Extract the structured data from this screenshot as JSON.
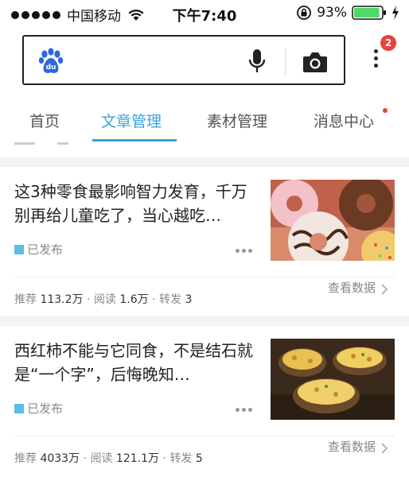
{
  "status_bar": {
    "carrier": "中国移动",
    "time": "下午7:40",
    "battery_percent": "93%",
    "battery_level": 0.93
  },
  "search": {
    "logo_text": "du",
    "notification_count": "2"
  },
  "tabs": [
    {
      "label": "首页",
      "active": false
    },
    {
      "label": "文章管理",
      "active": true
    },
    {
      "label": "素材管理",
      "active": false
    },
    {
      "label": "消息中心",
      "active": false,
      "has_dot": true
    }
  ],
  "articles": [
    {
      "title": "这3种零食最影响智力发育，千万别再给儿童吃了，当心越吃…",
      "status": "已发布",
      "stats": {
        "recommend_label": "推荐",
        "recommend": "113.2万",
        "read_label": "阅读",
        "read": "1.6万",
        "share_label": "转发",
        "share": "3"
      },
      "view_data": "查看数据",
      "thumbnail": "donuts-image"
    },
    {
      "title": "西红柿不能与它同食，不是结石就是“一个字”，后悔晚知…",
      "status": "已发布",
      "stats": {
        "recommend_label": "推荐",
        "recommend": "4033万",
        "read_label": "阅读",
        "read": "121.1万",
        "share_label": "转发",
        "share": "5"
      },
      "view_data": "查看数据",
      "thumbnail": "baked-potatoes-image"
    }
  ],
  "colors": {
    "accent": "#3aa3dc",
    "badge": "#e9423d",
    "status_square": "#5ebde8",
    "battery": "#4cd964"
  }
}
